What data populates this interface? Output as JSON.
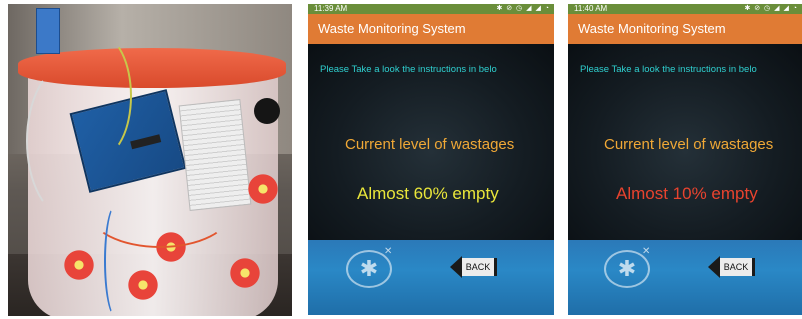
{
  "photo": {
    "description_icon": "arduino-bucket-photo"
  },
  "screens": [
    {
      "status_time": "11:39 AM",
      "status_icons": "✱ ⊘ ◷ ◢ ◢ ◔",
      "app_title": "Waste Monitoring System",
      "instructions": "Please Take a look the instructions in belo",
      "level_label": "Current level of wastages",
      "level_value": "Almost 60% empty",
      "level_color": "#e9e63a",
      "bluetooth_icon": "bluetooth-icon",
      "back_label": "BACK"
    },
    {
      "status_time": "11:40 AM",
      "status_icons": "✱ ⊘ ◷ ◢ ◢ ◔",
      "app_title": "Waste Monitoring System",
      "instructions": "Please Take a look the instructions in belo",
      "level_label": "Current level of wastages",
      "level_value": "Almost 10% empty",
      "level_color": "#e8432e",
      "bluetooth_icon": "bluetooth-icon",
      "back_label": "BACK"
    }
  ],
  "colors": {
    "title_bar": "#e07b34",
    "status_bar": "#6a8e3a",
    "instructions_text": "#2fd0d0",
    "level_label_text": "#f0a836"
  }
}
